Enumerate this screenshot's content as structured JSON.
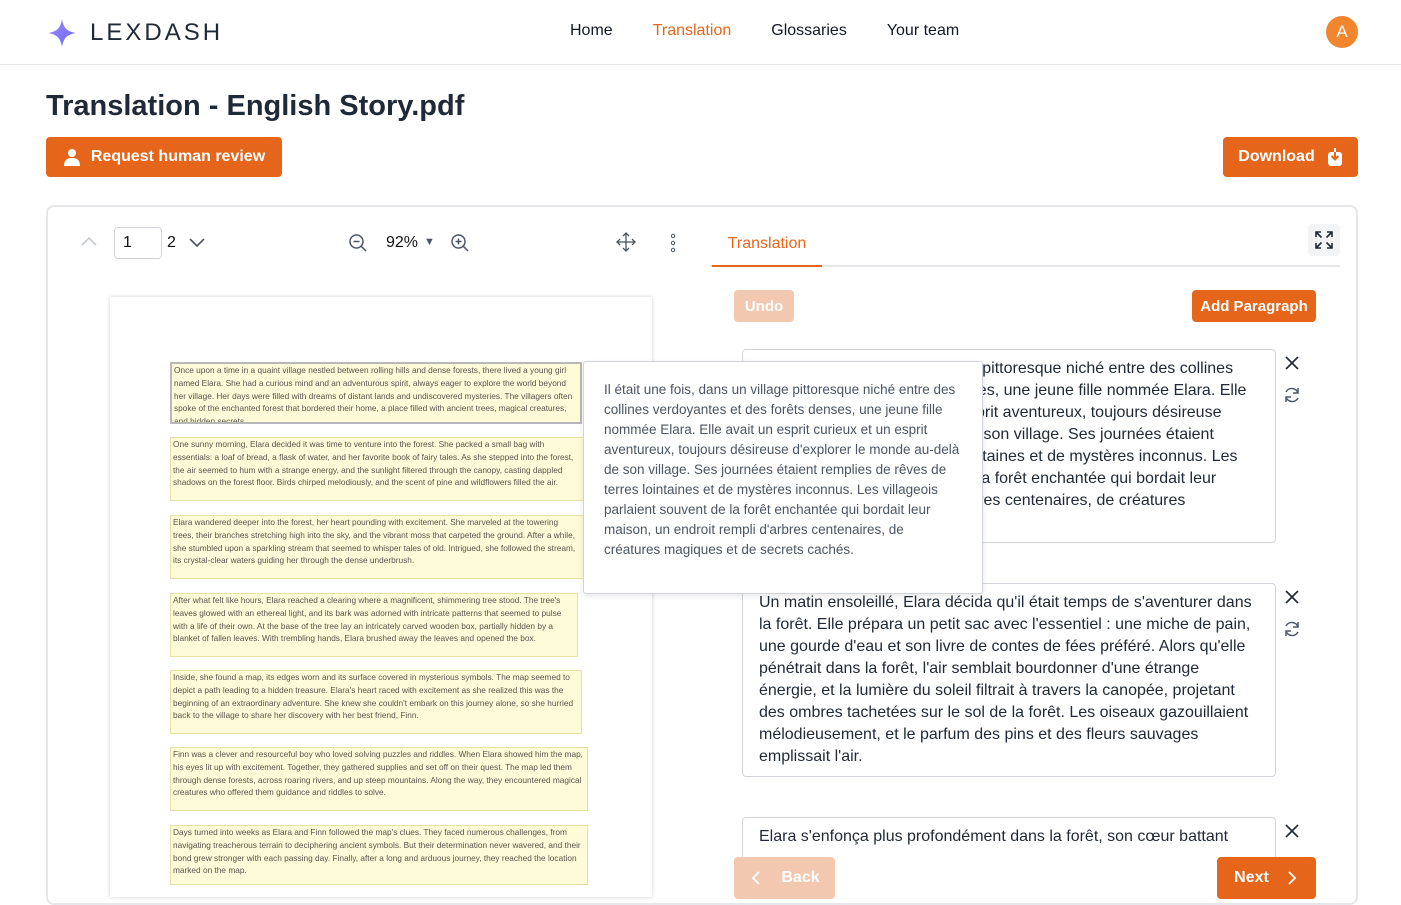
{
  "app": {
    "name": "LEXDASH"
  },
  "nav": {
    "links": [
      {
        "label": "Home",
        "active": false
      },
      {
        "label": "Translation",
        "active": true
      },
      {
        "label": "Glossaries",
        "active": false
      },
      {
        "label": "Your team",
        "active": false
      }
    ],
    "avatar_initial": "A"
  },
  "page": {
    "title": "Translation - English Story.pdf",
    "review_label": "Request human review",
    "download_label": "Download"
  },
  "viewer": {
    "current_page": "1",
    "total_pages": "2",
    "zoom": "92%",
    "paragraphs": [
      "Once upon a time in a quaint village nestled between rolling hills and dense forests, there lived a young girl named Elara. She had a curious mind and an adventurous spirit, always eager to explore the world beyond her village. Her days were filled with dreams of distant lands and undiscovered mysteries. The villagers often spoke of the enchanted forest that bordered their home, a place filled with ancient trees, magical creatures, and hidden secrets.",
      "One sunny morning, Elara decided it was time to venture into the forest. She packed a small bag with essentials: a loaf of bread, a flask of water, and her favorite book of fairy tales. As she stepped into the forest, the air seemed to hum with a strange energy, and the sunlight filtered through the canopy, casting dappled shadows on the forest floor. Birds chirped melodiously, and the scent of pine and wildflowers filled the air.",
      "Elara wandered deeper into the forest, her heart pounding with excitement. She marveled at the towering trees, their branches stretching high into the sky, and the vibrant moss that carpeted the ground. After a while, she stumbled upon a sparkling stream that seemed to whisper tales of old. Intrigued, she followed the stream, its crystal-clear waters guiding her through the dense underbrush.",
      "After what felt like hours, Elara reached a clearing where a magnificent, shimmering tree stood. The tree's leaves glowed with an ethereal light, and its bark was adorned with intricate patterns that seemed to pulse with a life of their own. At the base of the tree lay an intricately carved wooden box, partially hidden by a blanket of fallen leaves. With trembling hands, Elara brushed away the leaves and opened the box.",
      "Inside, she found a map, its edges worn and its surface covered in mysterious symbols. The map seemed to depict a path leading to a hidden treasure. Elara's heart raced with excitement as she realized this was the beginning of an extraordinary adventure. She knew she couldn't embark on this journey alone, so she hurried back to the village to share her discovery with her best friend, Finn.",
      "Finn was a clever and resourceful boy who loved solving puzzles and riddles. When Elara showed him the map, his eyes lit up with excitement. Together, they gathered supplies and set off on their quest. The map led them through dense forests, across roaring rivers, and up steep mountains. Along the way, they encountered magical creatures who offered them guidance and riddles to solve.",
      "Days turned into weeks as Elara and Finn followed the map's clues. They faced numerous challenges, from navigating treacherous terrain to deciphering ancient symbols. But their determination never wavered, and their bond grew stronger with each passing day. Finally, after a long and arduous journey, they reached the location marked on the map."
    ],
    "tooltip": "Il était une fois, dans un village pittoresque niché entre des collines verdoyantes et des forêts denses, une jeune fille nommée Elara. Elle avait un esprit curieux et un esprit aventureux, toujours désireuse d'explorer le monde au-delà de son village. Ses journées étaient remplies de rêves de terres lointaines et de mystères inconnus. Les villageois parlaient souvent de la forêt enchantée qui bordait leur maison, un endroit rempli d'arbres centenaires, de créatures magiques et de secrets cachés."
  },
  "translation": {
    "tab_label": "Translation",
    "undo_label": "Undo",
    "add_paragraph_label": "Add Paragraph",
    "paragraphs": [
      "Il était une fois, dans un village pittoresque niché entre des collines verdoyantes et des forêts denses, une jeune fille nommée Elara. Elle avait un esprit curieux et un esprit aventureux, toujours désireuse d'explorer le monde au-delà de son village. Ses journées étaient remplies de rêves de terres lointaines et de mystères inconnus. Les villageois parlaient souvent de la forêt enchantée qui bordait leur maison, un endroit rempli d'arbres centenaires, de créatures magiques et de secrets cachés.",
      "Un matin ensoleillé, Elara décida qu'il était temps de s'aventurer dans la forêt. Elle prépara un petit sac avec l'essentiel : une miche de pain, une gourde d'eau et son livre de contes de fées préféré. Alors qu'elle pénétrait dans la forêt, l'air semblait bourdonner d'une étrange énergie, et la lumière du soleil filtrait à travers la canopée, projetant des ombres tachetées sur le sol de la forêt. Les oiseaux gazouillaient mélodieusement, et le parfum des pins et des fleurs sauvages emplissait l'air.",
      "Elara s'enfonça plus profondément dans la forêt, son cœur battant"
    ],
    "back_label": "Back",
    "next_label": "Next"
  },
  "colors": {
    "accent": "#e5661b",
    "accent_disabled": "#f3c8b1",
    "highlight": "#fefcd8"
  },
  "icons": [
    "sparkle-logo-icon",
    "user-icon",
    "download-icon",
    "chevron-up-icon",
    "chevron-down-icon",
    "zoom-out-icon",
    "zoom-in-icon",
    "move-icon",
    "more-vertical-icon",
    "expand-icon",
    "close-icon",
    "refresh-icon",
    "chevron-left-icon",
    "chevron-right-icon"
  ]
}
